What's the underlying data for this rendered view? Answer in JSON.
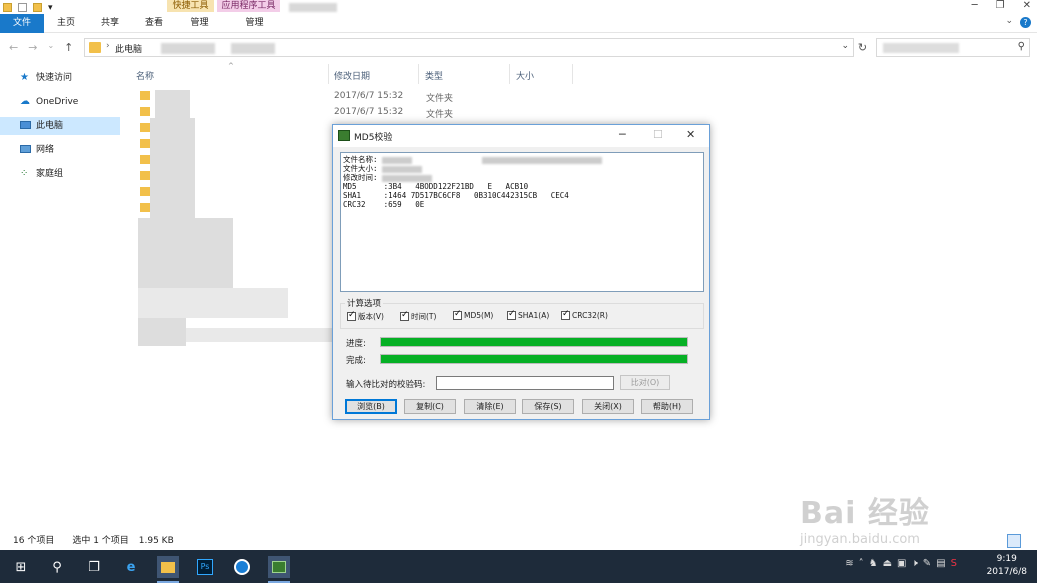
{
  "ribbon": {
    "context_quick": "快捷工具",
    "context_app": "应用程序工具",
    "tabs": [
      "文件",
      "主页",
      "共享",
      "查看",
      "管理",
      "管理"
    ]
  },
  "address": {
    "crumb": "此电脑"
  },
  "nav": {
    "items": [
      "快速访问",
      "OneDrive",
      "此电脑",
      "网络",
      "家庭组"
    ],
    "selected": "此电脑"
  },
  "columns": {
    "name": "名称",
    "date": "修改日期",
    "type": "类型",
    "size": "大小"
  },
  "files": [
    {
      "date": "2017/6/7 15:32",
      "type": "文件夹"
    },
    {
      "date": "2017/6/7 15:32",
      "type": "文件夹"
    },
    {
      "date": "",
      "type": "文件夹"
    }
  ],
  "status": {
    "count": "16 个项目",
    "selected": "选中 1 个项目",
    "size": "1.95 KB"
  },
  "dialog": {
    "title": "MD5校验",
    "result_lines": [
      {
        "label": "文件名称:",
        "value": ""
      },
      {
        "label": "文件大小:",
        "value": ""
      },
      {
        "label": "修改时间:",
        "value": ""
      },
      {
        "label": "MD5      :",
        "value": "3B4   4BODD122F21BD   E   ACB10"
      },
      {
        "label": "SHA1     :",
        "value": "1464 7D517BC6CF8   0B310C442315CB   CEC4"
      },
      {
        "label": "CRC32    :",
        "value": "659   0E"
      }
    ],
    "options_label": "计算选项",
    "options": [
      {
        "label": "版本(V)",
        "checked": true
      },
      {
        "label": "时间(T)",
        "checked": true
      },
      {
        "label": "MD5(M)",
        "checked": true
      },
      {
        "label": "SHA1(A)",
        "checked": true
      },
      {
        "label": "CRC32(R)",
        "checked": true
      }
    ],
    "progress_label": "进度:",
    "progress": 1.0,
    "done_label": "完成:",
    "done": 1.0,
    "compare_label": "输入待比对的校验码:",
    "compare_value": "",
    "compare_button": "比对(O)",
    "buttons": [
      "浏览(B)",
      "复制(C)",
      "清除(E)",
      "保存(S)",
      "关闭(X)",
      "帮助(H)"
    ]
  },
  "taskbar": {
    "time": "9:19",
    "date": "2017/6/8"
  },
  "watermark": {
    "text": "Bai 经验",
    "url": "jingyan.baidu.com"
  }
}
